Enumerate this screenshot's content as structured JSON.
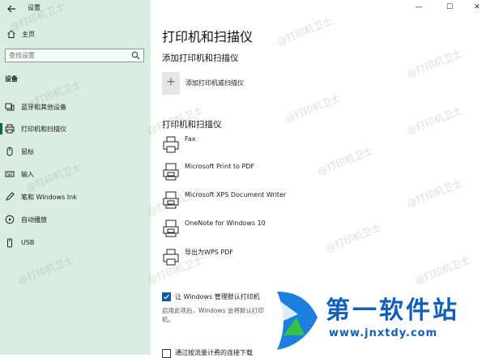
{
  "window": {
    "title": "设置",
    "minimize": "—",
    "maximize": "☐",
    "close": "✕"
  },
  "sidebar": {
    "home_label": "主页",
    "search_placeholder": "查找设置",
    "section_label": "设备",
    "items": [
      {
        "label": "蓝牙和其他设备",
        "icon": "bluetooth-icon"
      },
      {
        "label": "打印机和扫描仪",
        "icon": "printer-icon",
        "active": true
      },
      {
        "label": "鼠标",
        "icon": "mouse-icon"
      },
      {
        "label": "输入",
        "icon": "keyboard-icon"
      },
      {
        "label": "笔和 Windows Ink",
        "icon": "pen-icon"
      },
      {
        "label": "自动播放",
        "icon": "autoplay-icon"
      },
      {
        "label": "USB",
        "icon": "usb-icon"
      }
    ]
  },
  "main": {
    "title": "打印机和扫描仪",
    "add_section": "添加打印机和扫描仪",
    "add_button_label": "添加打印机或扫描仪",
    "list_section": "打印机和扫描仪",
    "printers": [
      {
        "name": "Fax",
        "icon": "fax-icon"
      },
      {
        "name": "Microsoft Print to PDF",
        "icon": "printer-icon"
      },
      {
        "name": "Microsoft XPS Document Writer",
        "icon": "printer-icon"
      },
      {
        "name": "OneNote for Windows 10",
        "icon": "printer-icon"
      },
      {
        "name": "导出为WPS PDF",
        "icon": "printer-icon"
      }
    ],
    "manage_default_label": "让 Windows 管理默认打印机",
    "manage_default_checked": true,
    "manage_default_desc": "启用此项后，Windows 会将默认打印机。",
    "metered_label": "通过按流量计费的连接下载"
  },
  "watermark": "@打印机卫士",
  "logo": {
    "text": "第一软件站",
    "url": "www.jnxtdy.com"
  },
  "colors": {
    "sidebar_bg": "#d9ede4",
    "accent": "#0b5cad",
    "logo_blue": "#0f5fbf"
  }
}
